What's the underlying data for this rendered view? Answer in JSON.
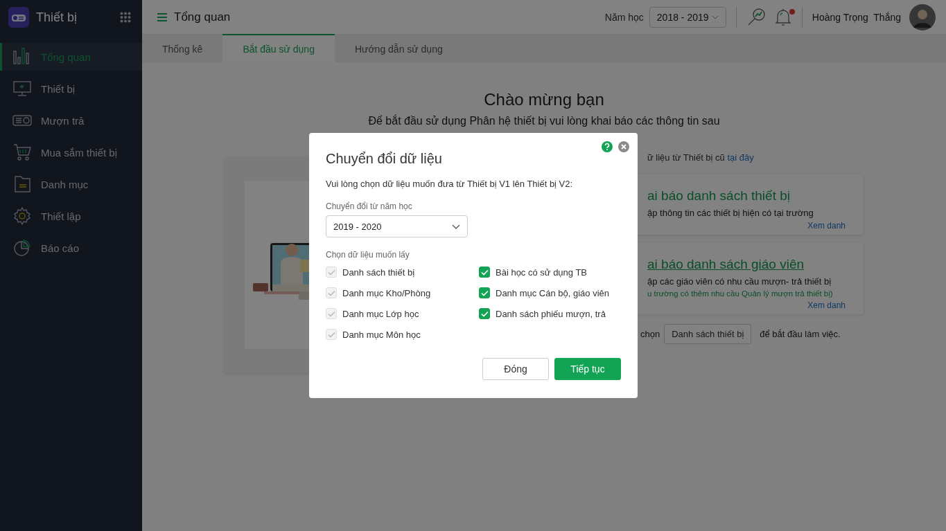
{
  "sidebar": {
    "app_title": "Thiết bị",
    "items": [
      {
        "label": "Tổng quan",
        "selected": true
      },
      {
        "label": "Thiết bị",
        "selected": false
      },
      {
        "label": "Mượn trả",
        "selected": false
      },
      {
        "label": "Mua sắm thiết bị",
        "selected": false
      },
      {
        "label": "Danh mục",
        "selected": false
      },
      {
        "label": "Thiết lập",
        "selected": false
      },
      {
        "label": "Báo cáo",
        "selected": false
      }
    ]
  },
  "header": {
    "title": "Tổng quan",
    "year_label": "Năm học",
    "year_value": "2018 - 2019",
    "notification_unread": true,
    "user_name": "Hoàng Trọng  Thắng"
  },
  "tabs": [
    {
      "label": "Thống kê",
      "selected": false
    },
    {
      "label": "Bắt đầu sử dụng",
      "selected": true
    },
    {
      "label": "Hướng dẫn sử dụng",
      "selected": false
    }
  ],
  "welcome": {
    "title": "Chào mừng bạn",
    "subtitle": "Để bắt đầu sử dụng Phân hệ thiết bị vui lòng khai báo các thông tin sau",
    "migrate_text": "ữ liệu từ Thiết bị cũ",
    "migrate_link": "tại đây",
    "cards": [
      {
        "title": "ai báo danh sách thiết bị",
        "hovered": false,
        "description": "ập thông tin các thiết bị hiện có tại trường",
        "link": "Xem danh"
      },
      {
        "title": "ai báo danh sách giáo viên",
        "hovered": true,
        "description": "ập các giáo viên có nhu cầu mượn- trả thiết bị",
        "note": "u trường có thêm nhu cầu Quản lý mượn trả thiết bị)",
        "link": "Xem danh"
      }
    ],
    "start_prefix": "chọn",
    "start_button": "Danh sách thiết bị",
    "start_suffix": "để bắt đầu làm việc."
  },
  "dialog": {
    "title": "Chuyển đổi dữ liệu",
    "instruction": "Vui lòng chọn dữ liệu muốn đưa từ Thiết bị V1 lên Thiết bị V2:",
    "year_label": "Chuyển đổi từ năm học",
    "year_value": "2019 - 2020",
    "data_label": "Chọn dữ liệu muốn lấy",
    "options": [
      {
        "label": "Danh sách thiết bị",
        "checked": true,
        "disabled": true
      },
      {
        "label": "Danh mục Kho/Phòng",
        "checked": true,
        "disabled": true
      },
      {
        "label": "Danh mục Lớp học",
        "checked": true,
        "disabled": true
      },
      {
        "label": "Danh mục Môn học",
        "checked": true,
        "disabled": true
      },
      {
        "label": "Bài học có sử dụng TB",
        "checked": true,
        "disabled": false
      },
      {
        "label": "Danh mục Cán bộ, giáo viên",
        "checked": true,
        "disabled": false
      },
      {
        "label": "Danh sách phiếu mượn, trả",
        "checked": true,
        "disabled": false
      }
    ],
    "buttons": [
      {
        "label": "Đóng",
        "kind": "secondary"
      },
      {
        "label": "Tiếp tục",
        "kind": "primary"
      }
    ]
  }
}
